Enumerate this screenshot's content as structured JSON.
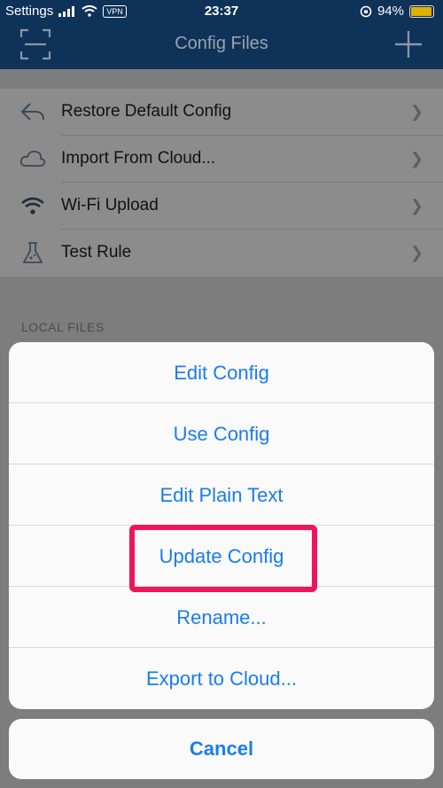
{
  "status_bar": {
    "carrier": "Settings",
    "time": "23:37",
    "battery": "94%",
    "vpn": "VPN"
  },
  "nav": {
    "title": "Config Files"
  },
  "menu": [
    {
      "label": "Restore Default Config",
      "icon": "restore-arrow-icon"
    },
    {
      "label": "Import From Cloud...",
      "icon": "cloud-icon"
    },
    {
      "label": "Wi-Fi Upload",
      "icon": "wifi-icon"
    },
    {
      "label": "Test Rule",
      "icon": "flask-icon"
    }
  ],
  "section": {
    "local_files": "LOCAL FILES"
  },
  "action_sheet": {
    "actions": [
      "Edit Config",
      "Use Config",
      "Edit Plain Text",
      "Update Config",
      "Rename...",
      "Export to Cloud..."
    ],
    "cancel": "Cancel"
  },
  "colors": {
    "accent": "#1a7cf0",
    "highlight": "#f0145a",
    "nav": "#0f3258"
  }
}
